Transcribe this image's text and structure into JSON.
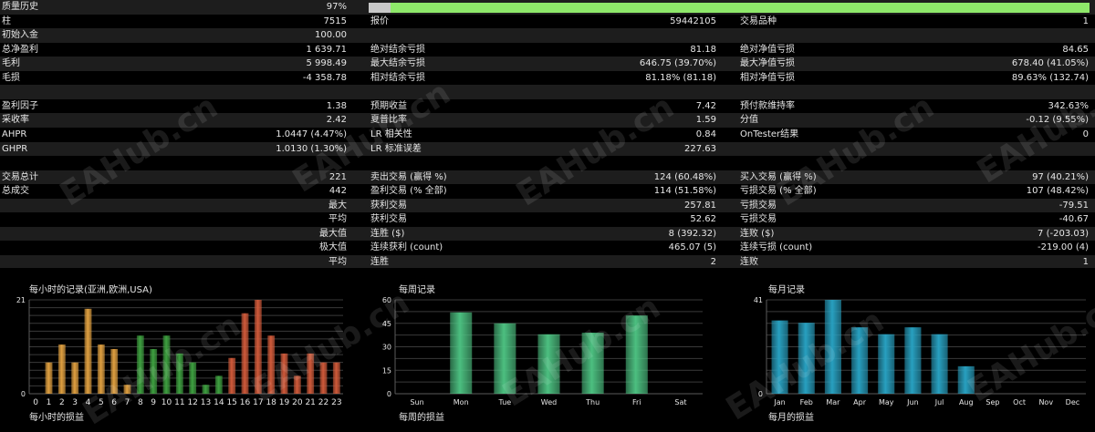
{
  "stats": {
    "quality_label": "质量历史",
    "quality_value": "97%",
    "quality_fraction": 0.97,
    "rows": [
      {
        "c1l": "柱",
        "c1v": "7515",
        "c2l": "报价",
        "c2v": "59442105",
        "c3l": "交易品种",
        "c3v": "1"
      },
      {
        "c1l": "初始入金",
        "c1v": "100.00",
        "c2l": "",
        "c2v": "",
        "c3l": "",
        "c3v": ""
      },
      {
        "c1l": "总净盈利",
        "c1v": "1 639.71",
        "c2l": "绝对结余亏损",
        "c2v": "81.18",
        "c3l": "绝对净值亏损",
        "c3v": "84.65"
      },
      {
        "c1l": "毛利",
        "c1v": "5 998.49",
        "c2l": "最大结余亏损",
        "c2v": "646.75 (39.70%)",
        "c3l": "最大净值亏损",
        "c3v": "678.40 (41.05%)"
      },
      {
        "c1l": "毛损",
        "c1v": "-4 358.78",
        "c2l": "相对结余亏损",
        "c2v": "81.18% (81.18)",
        "c3l": "相对净值亏损",
        "c3v": "89.63% (132.74)"
      },
      {
        "c1l": "",
        "c1v": "",
        "c2l": "",
        "c2v": "",
        "c3l": "",
        "c3v": ""
      },
      {
        "c1l": "盈利因子",
        "c1v": "1.38",
        "c2l": "预期收益",
        "c2v": "7.42",
        "c3l": "预付款维持率",
        "c3v": "342.63%"
      },
      {
        "c1l": "采收率",
        "c1v": "2.42",
        "c2l": "夏普比率",
        "c2v": "1.59",
        "c3l": "分值",
        "c3v": "-0.12 (9.55%)"
      },
      {
        "c1l": "AHPR",
        "c1v": "1.0447 (4.47%)",
        "c2l": "LR 相关性",
        "c2v": "0.84",
        "c3l": "OnTester结果",
        "c3v": "0"
      },
      {
        "c1l": "GHPR",
        "c1v": "1.0130 (1.30%)",
        "c2l": "LR 标准误差",
        "c2v": "227.63",
        "c3l": "",
        "c3v": ""
      },
      {
        "c1l": "",
        "c1v": "",
        "c2l": "",
        "c2v": "",
        "c3l": "",
        "c3v": ""
      },
      {
        "c1l": "交易总计",
        "c1v": "221",
        "c2l": "卖出交易 (赢得 %)",
        "c2v": "124 (60.48%)",
        "c3l": "买入交易 (赢得 %)",
        "c3v": "97 (40.21%)"
      },
      {
        "c1l": "总成交",
        "c1v": "442",
        "c2l": "盈利交易 (% 全部)",
        "c2v": "114 (51.58%)",
        "c3l": "亏损交易 (% 全部)",
        "c3v": "107 (48.42%)"
      },
      {
        "c1l": "",
        "c1v": "最大",
        "c2l": "获利交易",
        "c2v": "257.81",
        "c3l": "亏损交易",
        "c3v": "-79.51"
      },
      {
        "c1l": "",
        "c1v": "平均",
        "c2l": "获利交易",
        "c2v": "52.62",
        "c3l": "亏损交易",
        "c3v": "-40.67"
      },
      {
        "c1l": "",
        "c1v": "最大值",
        "c2l": "连胜 ($)",
        "c2v": "8 (392.32)",
        "c3l": "连败 ($)",
        "c3v": "7 (-203.03)"
      },
      {
        "c1l": "",
        "c1v": "极大值",
        "c2l": "连续获利 (count)",
        "c2v": "465.07 (5)",
        "c3l": "连续亏损 (count)",
        "c3v": "-219.00 (4)"
      },
      {
        "c1l": "",
        "c1v": "平均",
        "c2l": "连胜",
        "c2v": "2",
        "c3l": "连败",
        "c3v": "1"
      }
    ]
  },
  "watermark_text": "EAHub.cn",
  "colors": {
    "hour_asia": "#e0a040",
    "hour_europe": "#3ea040",
    "hour_usa": "#d05a3a",
    "week": "#4cbf80",
    "month": "#28a0c0",
    "quality": "#8ee86a"
  },
  "chart_data": [
    {
      "type": "bar",
      "title": "每小时的记录(亚洲,欧洲,USA)",
      "footer": "每小时的损益",
      "categories": [
        "0",
        "1",
        "2",
        "3",
        "4",
        "5",
        "6",
        "7",
        "8",
        "9",
        "10",
        "11",
        "12",
        "13",
        "14",
        "15",
        "16",
        "17",
        "18",
        "19",
        "20",
        "21",
        "22",
        "23"
      ],
      "values": [
        0,
        7,
        11,
        7,
        19,
        11,
        10,
        2,
        13,
        10,
        13,
        9,
        7,
        2,
        4,
        8,
        18,
        21,
        13,
        9,
        4,
        9,
        7,
        7
      ],
      "ylim": [
        0,
        21
      ],
      "yticks": [
        "0",
        "21"
      ],
      "grid": true
    },
    {
      "type": "bar",
      "title": "每周记录",
      "footer": "每周的损益",
      "categories": [
        "Sun",
        "Mon",
        "Tue",
        "Wed",
        "Thu",
        "Fri",
        "Sat"
      ],
      "values": [
        0,
        52,
        45,
        38,
        39,
        50,
        0
      ],
      "ylim": [
        0,
        60
      ],
      "yticks": [
        "0",
        "15",
        "30",
        "45",
        "60"
      ],
      "grid": true
    },
    {
      "type": "bar",
      "title": "每月记录",
      "footer": "每月的损益",
      "categories": [
        "Jan",
        "Feb",
        "Mar",
        "Apr",
        "May",
        "Jun",
        "Jul",
        "Aug",
        "Sep",
        "Oct",
        "Nov",
        "Dec"
      ],
      "values": [
        32,
        31,
        41,
        29,
        26,
        29,
        26,
        12,
        0,
        0,
        0,
        0
      ],
      "ylim": [
        0,
        41
      ],
      "yticks": [
        "0",
        "41"
      ],
      "grid": true
    }
  ]
}
